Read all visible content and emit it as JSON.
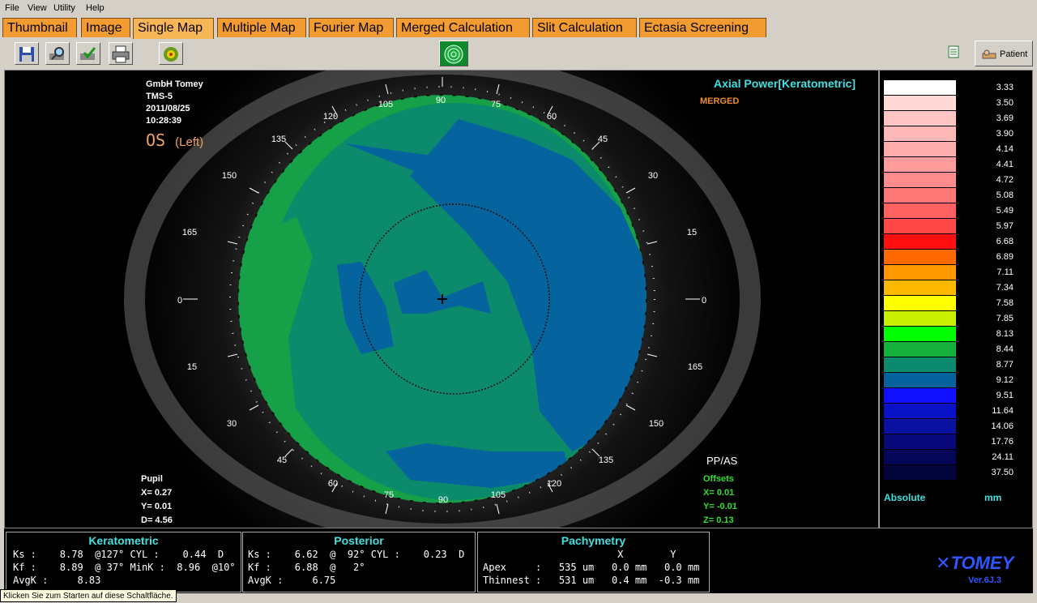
{
  "menu": [
    "File",
    "View",
    "Utility",
    "Help"
  ],
  "tabs": [
    "Thumbnail",
    "Image",
    "Single Map",
    "Multiple Map",
    "Fourier Map",
    "Merged Calculation",
    "Slit Calculation",
    "Ectasia Screening"
  ],
  "active_tab": "Single Map",
  "toolbar": {
    "patient_label": "Patient"
  },
  "exam": {
    "company": "GmbH Tomey",
    "device": "TMS-5",
    "date": "2011/08/25",
    "time": "10:28:39",
    "eye": "OS",
    "eye_side": "(Left)"
  },
  "map": {
    "title": "Axial Power[Keratometric]",
    "mode": "MERGED",
    "ppas": "PP/AS"
  },
  "angles": {
    "top": [
      "105",
      "90",
      "75",
      "120",
      "60",
      "135",
      "45",
      "150",
      "30",
      "165",
      "15",
      "0"
    ],
    "bottom": [
      "0",
      "15",
      "165",
      "30",
      "150",
      "45",
      "135",
      "60",
      "120",
      "75",
      "105",
      "90"
    ]
  },
  "pupil": {
    "label": "Pupil",
    "x": "X=  0.27",
    "y": "Y=  0.01",
    "d": "D=  4.56"
  },
  "offsets": {
    "label": "Offsets",
    "x": "X=  0.01",
    "y": "Y= -0.01",
    "z": "Z=  0.13"
  },
  "scale": {
    "values": [
      "3.33",
      "3.50",
      "3.69",
      "3.90",
      "4.14",
      "4.41",
      "4.72",
      "5.08",
      "5.49",
      "5.97",
      "6.68",
      "6.89",
      "7.11",
      "7.34",
      "7.58",
      "7.85",
      "8.13",
      "8.44",
      "8.77",
      "9.12",
      "9.51",
      "11.64",
      "14.06",
      "17.76",
      "24.11",
      "37.50"
    ],
    "colors": [
      "#ffffff",
      "#ffd8d8",
      "#ffc4c4",
      "#ffb8b8",
      "#ffacac",
      "#ff9c9c",
      "#ff8c8c",
      "#ff7878",
      "#ff6060",
      "#ff4848",
      "#ff1010",
      "#ff6a00",
      "#ff9800",
      "#ffb800",
      "#ffff00",
      "#c8f000",
      "#00ff00",
      "#16b13c",
      "#0a8b6e",
      "#05629c",
      "#1010ff",
      "#0a12c8",
      "#0a10a0",
      "#08087a",
      "#060658",
      "#04043c"
    ],
    "absolute_label": "Absolute",
    "unit_label": "mm"
  },
  "keratometric": {
    "title": "Keratometric",
    "ks": "Ks :    8.78  @127° CYL :    0.44  D",
    "kf": "Kf :    8.89  @ 37° MinK :  8.96  @10°",
    "avgk": "AvgK :     8.83"
  },
  "posterior": {
    "title": "Posterior",
    "ks": "Ks :    6.62  @  92° CYL :    0.23  D",
    "kf": "Kf :    6.88  @   2°",
    "avgk": "AvgK :     6.75"
  },
  "pachymetry": {
    "title": "Pachymetry",
    "header": "                       X        Y",
    "apex": "Apex     :   535 um   0.0 mm   0.0 mm",
    "thinnest": "Thinnest :   531 um   0.4 mm  -0.3 mm"
  },
  "brand": {
    "logo": "TOMEY",
    "version": "Ver.6J.3"
  },
  "tooltip": "Klicken Sie zum Starten auf diese Schaltfläche."
}
